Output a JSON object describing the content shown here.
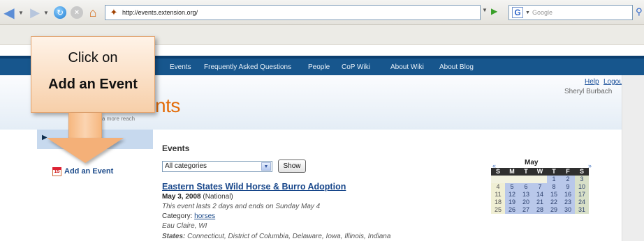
{
  "browser": {
    "url": "http://events.extension.org/",
    "search_placeholder": "Google",
    "search_engine_letter": "G"
  },
  "site_nav": {
    "items": [
      "Events",
      "Frequently Asked Questions",
      "People",
      "CoP Wiki",
      "About Wiki",
      "About Blog"
    ]
  },
  "header": {
    "title_fragment": "nts",
    "subtext_fragment": "a more reach",
    "help_label": "Help",
    "logout_label": "Logout",
    "username": "Sheryl Burbach"
  },
  "sidebar": {
    "add_event_label": "Add an Event"
  },
  "content": {
    "heading": "Events",
    "category_select_value": "All categories",
    "show_button_label": "Show",
    "event": {
      "title": "Eastern States Wild Horse & Burro Adoption",
      "date": "May 3, 2008",
      "scope": "(National)",
      "duration": "This event lasts 2 days and ends on Sunday May 4",
      "category_label": "Category:",
      "category_value": "horses",
      "location": "Eau Claire, WI",
      "states_label": "States:",
      "states_value": "Connecticut, District of Columbia, Delaware, Iowa, Illinois, Indiana"
    }
  },
  "calendar": {
    "month": "May",
    "prev_symbol": "«",
    "next_symbol": "»",
    "day_headers": [
      "S",
      "M",
      "T",
      "W",
      "T",
      "F",
      "S"
    ],
    "weeks": [
      [
        "",
        "",
        "",
        "",
        "1",
        "2",
        "3"
      ],
      [
        "4",
        "5",
        "6",
        "7",
        "8",
        "9",
        "10"
      ],
      [
        "11",
        "12",
        "13",
        "14",
        "15",
        "16",
        "17"
      ],
      [
        "18",
        "19",
        "20",
        "21",
        "22",
        "23",
        "24"
      ],
      [
        "25",
        "26",
        "27",
        "28",
        "29",
        "30",
        "31"
      ]
    ]
  },
  "callout": {
    "line1": "Click on",
    "line2": "Add an Event"
  }
}
